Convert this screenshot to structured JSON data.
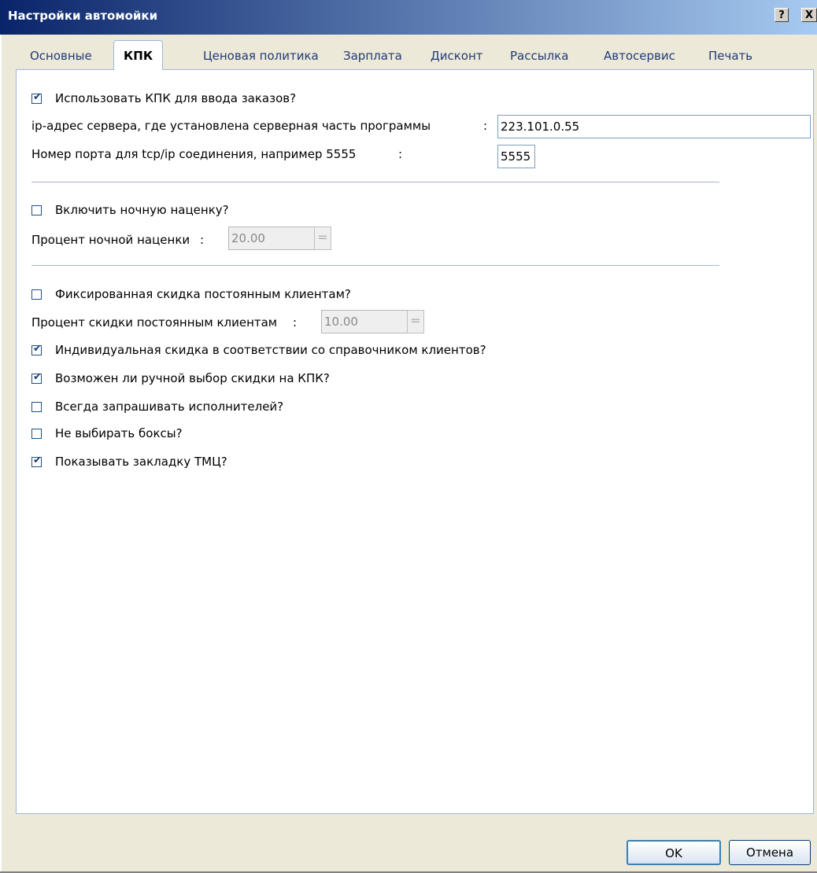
{
  "window": {
    "title": "Настройки автомойки",
    "help_button": "?",
    "close_button": "X"
  },
  "tabs": [
    {
      "label": "Основные"
    },
    {
      "label": "КПК"
    },
    {
      "label": "Ценовая политика"
    },
    {
      "label": "Зарплата"
    },
    {
      "label": "Дисконт"
    },
    {
      "label": "Рассылка"
    },
    {
      "label": "Автосервис"
    },
    {
      "label": "Печать"
    }
  ],
  "kpk": {
    "use_kpk_label": "Использовать КПК для ввода заказов?",
    "use_kpk_checked": true,
    "server_ip_label": "ip-адрес сервера, где установлена серверная часть программы",
    "server_ip_colon": ":",
    "server_ip_value": "223.101.0.55",
    "port_label": "Номер порта для tcp/ip соединения, например 5555",
    "port_colon": ":",
    "port_value": "5555"
  },
  "night": {
    "enable_label": "Включить ночную наценку?",
    "enable_checked": false,
    "percent_label": "Процент ночной наценки",
    "percent_colon": ":",
    "percent_value": "20.00"
  },
  "discount": {
    "fixed_label": "Фиксированная скидка постоянным клиентам?",
    "fixed_checked": false,
    "percent_label": "Процент скидки постоянным клиентам",
    "percent_colon": ":",
    "percent_value": "10.00",
    "individual_label": "Индивидуальная скидка в соответствии со справочником клиентов?",
    "individual_checked": true,
    "manual_label": "Возможен ли ручной выбор скидки на КПК?",
    "manual_checked": true,
    "ask_performers_label": "Всегда запрашивать исполнителей?",
    "ask_performers_checked": false,
    "no_boxes_label": "Не выбирать боксы?",
    "no_boxes_checked": false,
    "show_tmc_label": "Показывать закладку ТМЦ?",
    "show_tmc_checked": true
  },
  "buttons": {
    "ok": "OK",
    "cancel": "Отмена"
  },
  "spin_glyph": "="
}
